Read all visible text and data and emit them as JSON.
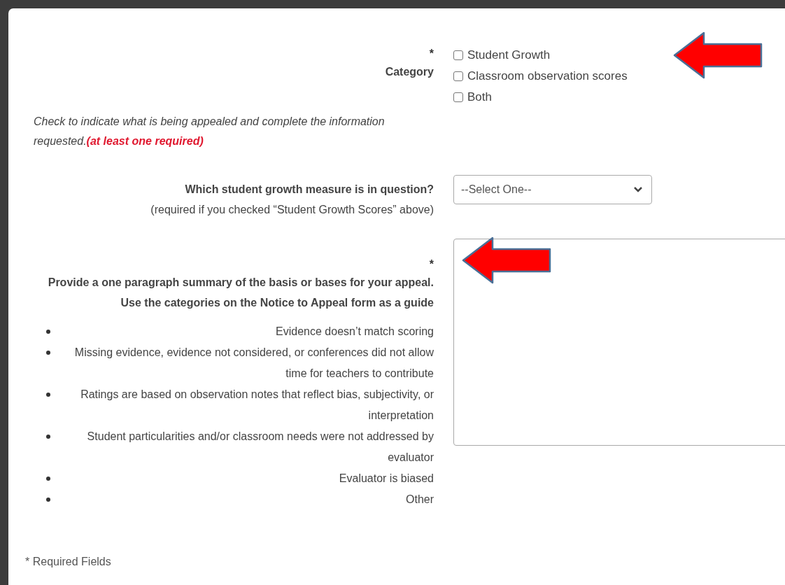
{
  "category": {
    "asterisk": "*",
    "label": "Category",
    "options": [
      {
        "label": "Student Growth",
        "checked": false
      },
      {
        "label": "Classroom observation scores",
        "checked": false
      },
      {
        "label": "Both",
        "checked": false
      }
    ]
  },
  "note": {
    "text": "Check to indicate what is being appealed and complete the information requested.",
    "emphasis": "(at least one required)"
  },
  "growth_measure": {
    "label": "Which student growth measure is in question?",
    "hint": "(required if you checked “Student Growth Scores” above)",
    "select": {
      "value": "--Select One--"
    }
  },
  "summary": {
    "asterisk": "*",
    "label": "Provide a one paragraph summary of the basis or bases for your appeal. Use the categories on the Notice to Appeal form as a guide",
    "bullets": [
      "Evidence doesn’t match scoring",
      "Missing evidence, evidence not considered, or conferences did not allow time for teachers to contribute",
      "Ratings are based on observation notes that reflect bias, subjectivity, or interpretation",
      "Student particularities and/or classroom needs were not addressed by evaluator",
      "Evaluator is biased",
      "Other"
    ]
  },
  "footer": "* Required Fields"
}
